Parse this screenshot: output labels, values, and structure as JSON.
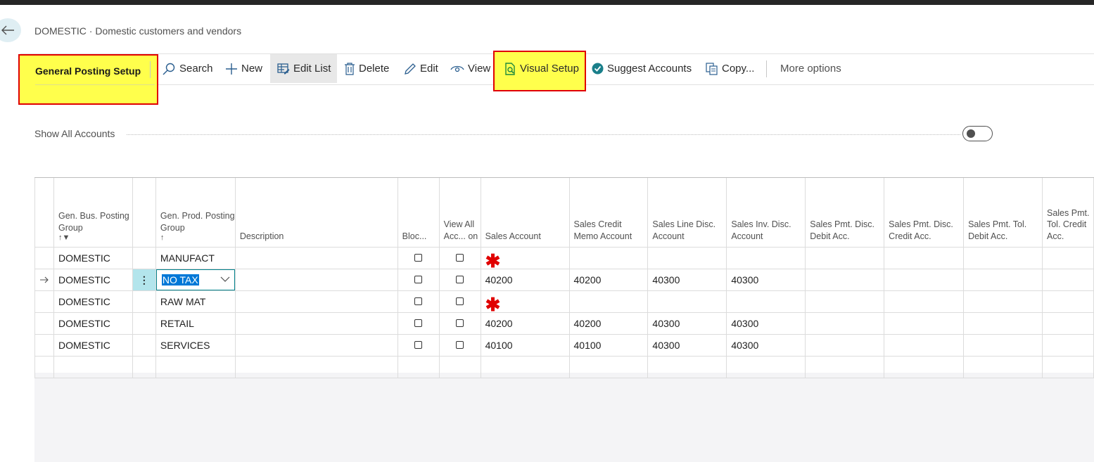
{
  "breadcrumb": "DOMESTIC · Domestic customers and vendors",
  "page_title": "General Posting Setup",
  "actions": {
    "search": "Search",
    "new": "New",
    "edit_list": "Edit List",
    "delete": "Delete",
    "edit": "Edit",
    "view": "View",
    "visual_setup": "Visual Setup",
    "suggest_accounts": "Suggest Accounts",
    "copy": "Copy...",
    "more_options": "More options"
  },
  "show_all_accounts": {
    "label": "Show All Accounts",
    "on": false
  },
  "columns": {
    "gen_bus": "Gen. Bus. Posting Group",
    "gen_prod": "Gen. Prod. Posting Group",
    "description": "Description",
    "blocked": "Bloc...",
    "view_all": "View All Acc... on",
    "sales_account": "Sales Account",
    "sales_credit_memo": "Sales Credit Memo Account",
    "sales_line_disc": "Sales Line Disc. Account",
    "sales_inv_disc": "Sales Inv. Disc. Account",
    "sales_pmt_disc_debit": "Sales Pmt. Disc. Debit Acc.",
    "sales_pmt_disc_credit": "Sales Pmt. Disc. Credit Acc.",
    "sales_pmt_tol_debit": "Sales Pmt. Tol. Debit Acc.",
    "sales_pmt_tol_credit": "Sales Pmt. Tol. Credit Acc."
  },
  "rows": [
    {
      "bus": "DOMESTIC",
      "prod": "MANUFACT",
      "sales": "",
      "credit_memo": "",
      "line_disc": "",
      "inv_disc": "",
      "missing": true
    },
    {
      "bus": "DOMESTIC",
      "prod": "NO TAX",
      "sales": "40200",
      "credit_memo": "40200",
      "line_disc": "40300",
      "inv_disc": "40300",
      "current": true
    },
    {
      "bus": "DOMESTIC",
      "prod": "RAW MAT",
      "sales": "",
      "credit_memo": "",
      "line_disc": "",
      "inv_disc": "",
      "missing": true
    },
    {
      "bus": "DOMESTIC",
      "prod": "RETAIL",
      "sales": "40200",
      "credit_memo": "40200",
      "line_disc": "40300",
      "inv_disc": "40300"
    },
    {
      "bus": "DOMESTIC",
      "prod": "SERVICES",
      "sales": "40100",
      "credit_memo": "40100",
      "line_disc": "40300",
      "inv_disc": "40300"
    }
  ],
  "colors": {
    "highlight": "#ffff4c",
    "callout_border": "#e00000",
    "accent": "#00828c",
    "required": "#e00000"
  }
}
